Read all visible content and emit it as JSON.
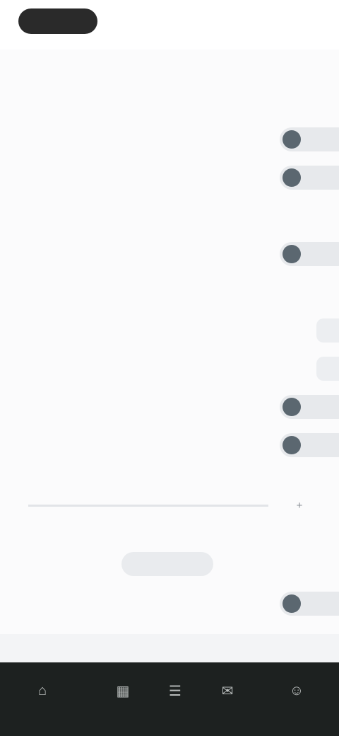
{
  "header": {
    "pill_label": "",
    "right_label": "",
    "title": ""
  },
  "section": {
    "label": ""
  },
  "rows": [
    {
      "label": "",
      "kind": "toggle",
      "on": true
    },
    {
      "label": "",
      "kind": "toggle",
      "on": true
    },
    {
      "label": "",
      "kind": "value",
      "value": ""
    },
    {
      "label": "",
      "kind": "toggle",
      "on": true
    },
    {
      "label": "",
      "kind": "value",
      "value": ""
    },
    {
      "label": "",
      "kind": "chevron",
      "value": ""
    },
    {
      "label": "",
      "kind": "chevron",
      "value": ""
    },
    {
      "label": "",
      "kind": "toggle",
      "on": true
    },
    {
      "label": "",
      "kind": "toggle",
      "on": true
    }
  ],
  "slider": {
    "label": "",
    "ticks": [
      "",
      "",
      "",
      ""
    ],
    "plus": "+"
  },
  "segmented": {
    "label": "",
    "options": [
      "",
      "",
      ""
    ],
    "selected_index": 1
  },
  "last_toggle": {
    "label": "",
    "on": true
  },
  "bottom_tabs": [
    "",
    "",
    ""
  ],
  "navbar": {
    "items": [
      {
        "icon": "home-icon",
        "label": ""
      },
      {
        "icon": "grid-icon",
        "label": ""
      },
      {
        "icon": "list-icon",
        "label": ""
      },
      {
        "icon": "chat-icon",
        "label": ""
      },
      {
        "icon": "person-icon",
        "label": ""
      }
    ]
  },
  "colors": {
    "accent_knob": "#5b6770",
    "navbar_bg": "#1d2120"
  }
}
